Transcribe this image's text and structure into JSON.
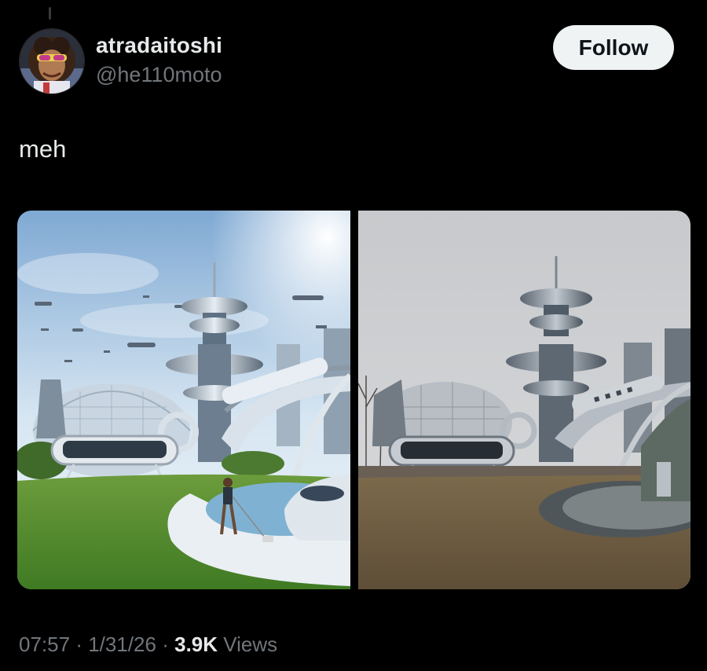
{
  "author": {
    "display_name": "atradaitoshi",
    "handle": "@he110moto",
    "avatar_icon": "profile-photo"
  },
  "follow_label": "Follow",
  "tweet": {
    "text": "meh"
  },
  "media": [
    {
      "name": "futuristic-city-render"
    },
    {
      "name": "futuristic-city-reality"
    }
  ],
  "meta": {
    "time": "07:57",
    "separator1": "·",
    "date": "1/31/26",
    "separator2": "·",
    "views_count": "3.9K",
    "views_label": "Views"
  },
  "colors": {
    "background": "#000000",
    "primary_text": "#e7e9ea",
    "secondary_text": "#71767b",
    "follow_button_bg": "#eff3f4"
  }
}
